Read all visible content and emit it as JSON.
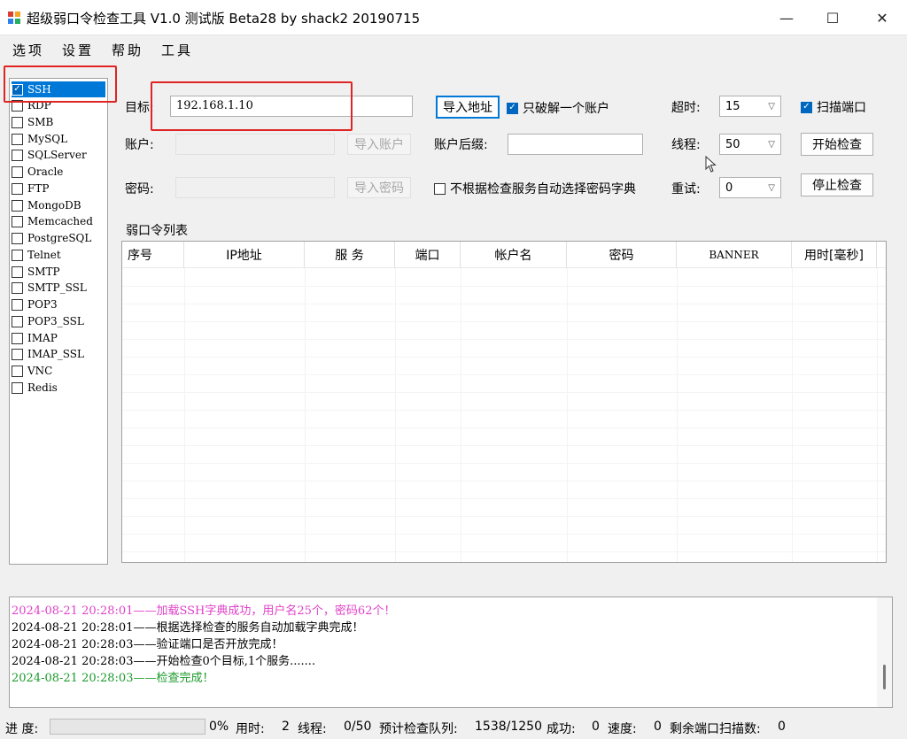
{
  "window": {
    "title": "超级弱口令检查工具 V1.0 测试版 Beta28 by shack2 20190715",
    "minimize": "—",
    "maximize": "☐",
    "close": "✕"
  },
  "menu": [
    "选项",
    "设置",
    "帮助",
    "工具"
  ],
  "services": [
    {
      "label": "SSH",
      "checked": true
    },
    {
      "label": "RDP",
      "checked": false
    },
    {
      "label": "SMB",
      "checked": false
    },
    {
      "label": "MySQL",
      "checked": false
    },
    {
      "label": "SQLServer",
      "checked": false
    },
    {
      "label": "Oracle",
      "checked": false
    },
    {
      "label": "FTP",
      "checked": false
    },
    {
      "label": "MongoDB",
      "checked": false
    },
    {
      "label": "Memcached",
      "checked": false
    },
    {
      "label": "PostgreSQL",
      "checked": false
    },
    {
      "label": "Telnet",
      "checked": false
    },
    {
      "label": "SMTP",
      "checked": false
    },
    {
      "label": "SMTP_SSL",
      "checked": false
    },
    {
      "label": "POP3",
      "checked": false
    },
    {
      "label": "POP3_SSL",
      "checked": false
    },
    {
      "label": "IMAP",
      "checked": false
    },
    {
      "label": "IMAP_SSL",
      "checked": false
    },
    {
      "label": "VNC",
      "checked": false
    },
    {
      "label": "Redis",
      "checked": false
    }
  ],
  "form": {
    "target_label": "目标:",
    "target_value": "192.168.1.10",
    "import_address": "导入地址",
    "only_one_account": "只破解一个账户",
    "timeout_label": "超时:",
    "timeout_value": "15",
    "scan_port": "扫描端口",
    "account_label": "账户:",
    "import_account": "导入账户",
    "account_suffix_label": "账户后缀:",
    "threads_label": "线程:",
    "threads_value": "50",
    "start_check": "开始检查",
    "password_label": "密码:",
    "import_password": "导入密码",
    "no_auto_dict": "不根据检查服务自动选择密码字典",
    "retry_label": "重试:",
    "retry_value": "0",
    "stop_check": "停止检查"
  },
  "list_title": "弱口令列表",
  "columns": [
    "序号",
    "IP地址",
    "服 务",
    "端口",
    "帐户名",
    "密码",
    "BANNER",
    "用时[毫秒]"
  ],
  "log": [
    {
      "text": "2024-08-21 20:28:01——加载SSH字典成功，用户名25个，密码62个！",
      "color": "#e040c8"
    },
    {
      "text": "2024-08-21 20:28:01——根据选择检查的服务自动加载字典完成！",
      "color": "#000000"
    },
    {
      "text": "2024-08-21 20:28:03——验证端口是否开放完成！",
      "color": "#000000"
    },
    {
      "text": "2024-08-21 20:28:03——开始检查0个目标,1个服务.......",
      "color": "#000000"
    },
    {
      "text": "2024-08-21 20:28:03——检查完成！",
      "color": "#1a9a2a"
    }
  ],
  "status": {
    "progress_label": "进 度:",
    "progress_value": "0%",
    "time_label": "用时:",
    "time_value": "2",
    "thread_label": "线程:",
    "thread_value": "0/50",
    "queue_label": "预计检查队列:",
    "queue_value": "1538/1250",
    "success_label": "成功:",
    "success_value": "0",
    "speed_label": "速度:",
    "speed_value": "0",
    "remaining_label": "剩余端口扫描数:",
    "remaining_value": "0"
  },
  "colors": {
    "accent": "#0078d7",
    "highlight": "#e02424"
  }
}
